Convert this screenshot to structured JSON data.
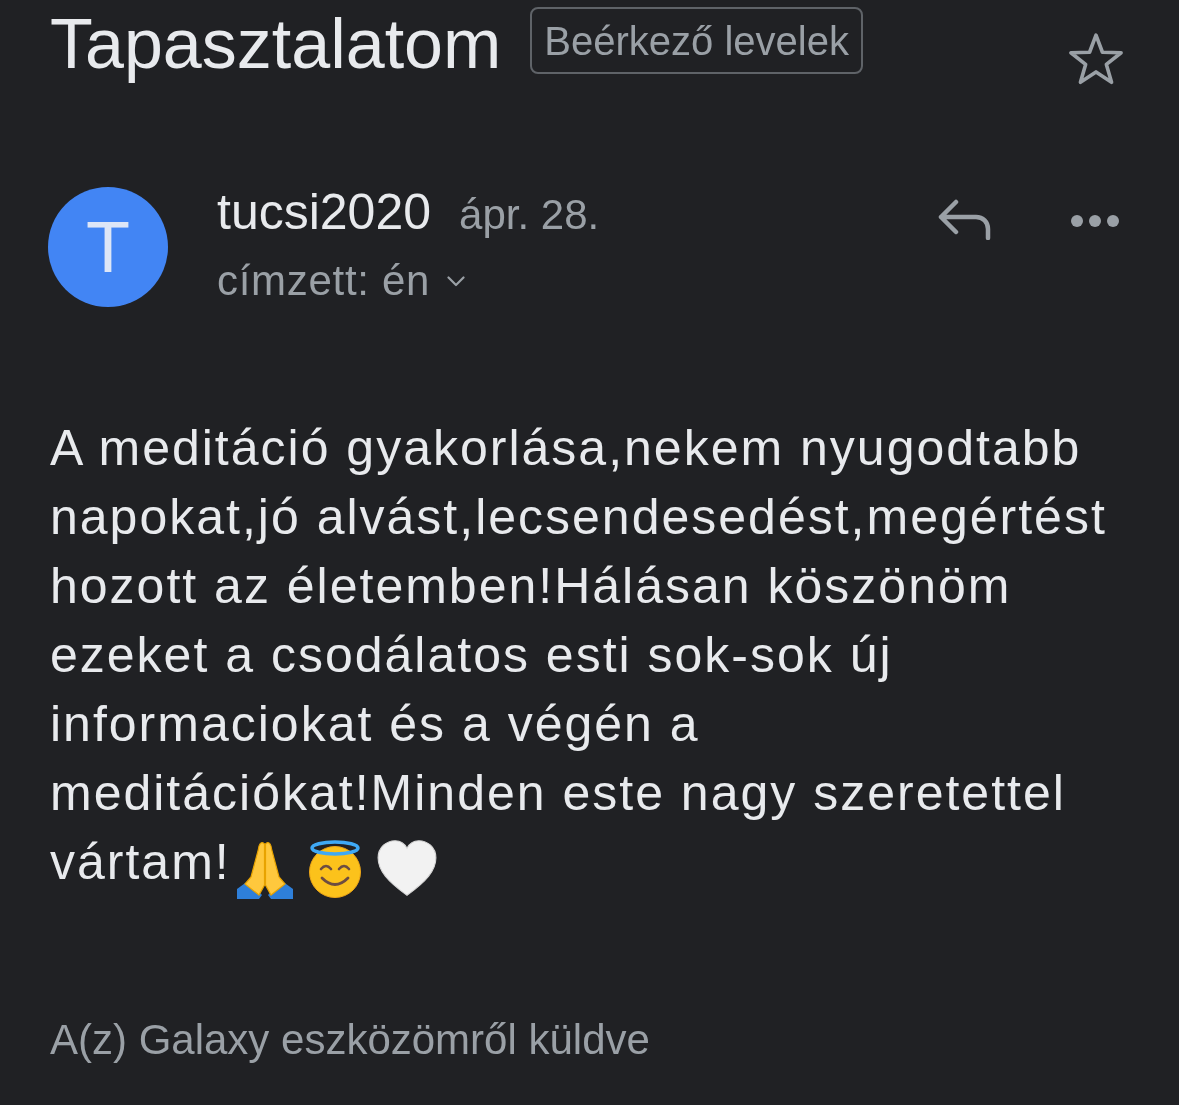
{
  "header": {
    "subject": "Tapasztalatom",
    "label": "Beérkező levelek",
    "starred": false
  },
  "message": {
    "avatar_letter": "T",
    "sender": "tucsi2020",
    "date": "ápr. 28.",
    "recipient": "címzett: én",
    "body": [
      "A meditáció gyakorlása,nekem nyugodtabb napokat,jó alvást,lecsendesedést,megértést hozott az életemben!Hálásan köszönöm ezeket a csodálatos esti sok-sok új informaciokat és a végén a meditációkat!Minden este nagy szeretettel",
      "vártam!"
    ],
    "signature": "A(z) Galaxy eszközömről küldve"
  }
}
